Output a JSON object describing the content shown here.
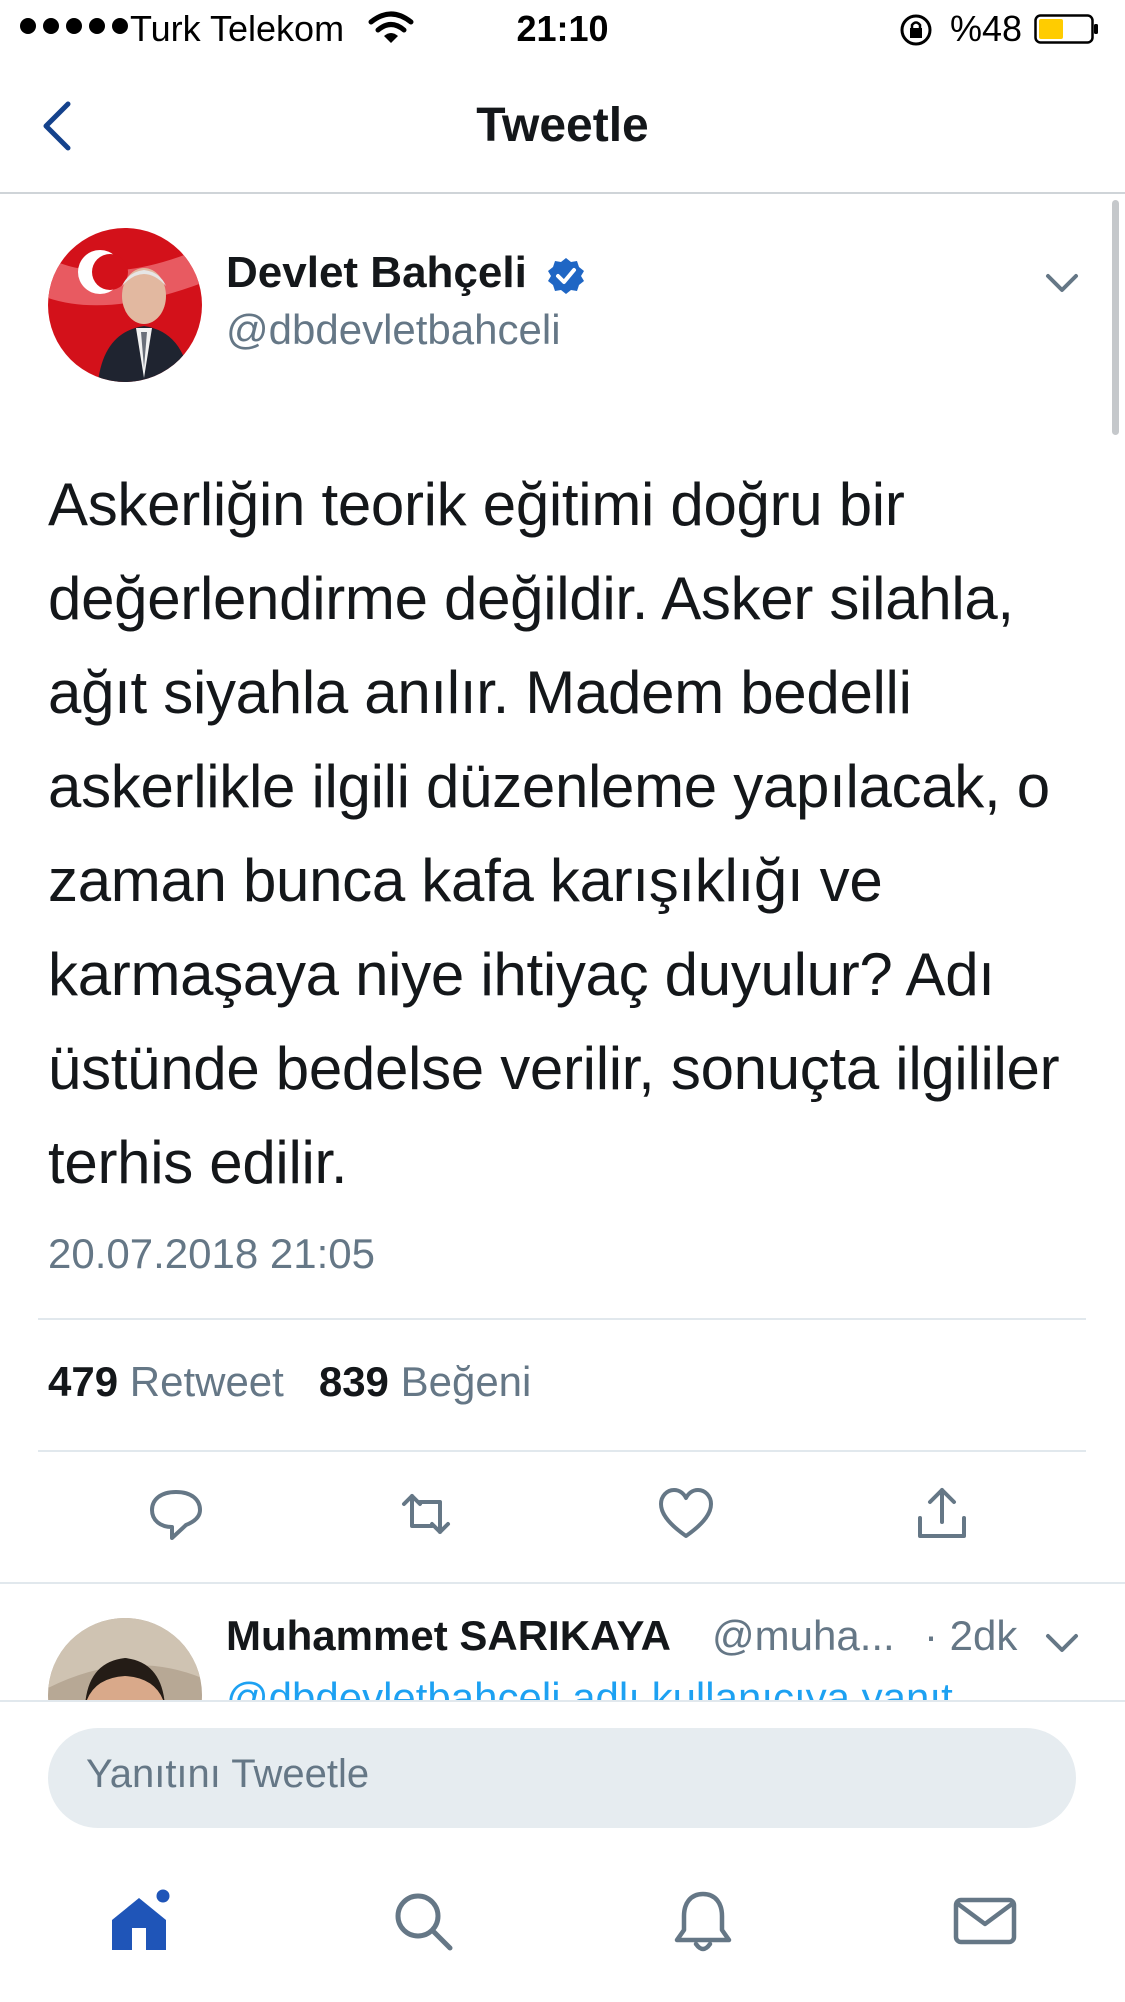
{
  "status_bar": {
    "carrier": "Turk Telekom",
    "time": "21:10",
    "battery_percent": "%48",
    "battery_level": 0.48,
    "battery_color": "#ffcc00"
  },
  "nav": {
    "title": "Tweetle"
  },
  "tweet": {
    "author_name": "Devlet Bahçeli",
    "author_handle": "@dbdevletbahceli",
    "verified": true,
    "text": "Askerliğin teorik eğitimi doğru bir değerlendirme değildir. Asker silahla, ağıt siyahla anılır. Madem bedelli askerlikle ilgili düzenleme yapılacak, o zaman bunca kafa karışıklığı ve karmaşaya niye ihtiyaç duyulur? Adı üstünde bedelse verilir, sonuçta ilgililer terhis edilir.",
    "timestamp": "20.07.2018 21:05",
    "retweet_count": "479",
    "retweet_label": "Retweet",
    "like_count": "839",
    "like_label": "Beğeni"
  },
  "reply_preview": {
    "name": "Muhammet SARIKAYA",
    "handle": "@muha...",
    "time": "· 2dk",
    "reply_to": "@dbdevletbahceli adlı kullanıcıya yanıt"
  },
  "composer": {
    "placeholder": "Yanıtını Tweetle"
  },
  "icons": {
    "back": "chevron-left-icon",
    "verified": "verified-badge-icon",
    "reply": "reply-icon",
    "retweet": "retweet-icon",
    "like": "heart-icon",
    "share": "share-icon",
    "home": "home-icon",
    "search": "search-icon",
    "notifications": "bell-icon",
    "messages": "mail-icon"
  },
  "colors": {
    "accent": "#1da1f2",
    "nav_icon": "#14428c",
    "muted": "#657786",
    "text": "#14171a"
  }
}
